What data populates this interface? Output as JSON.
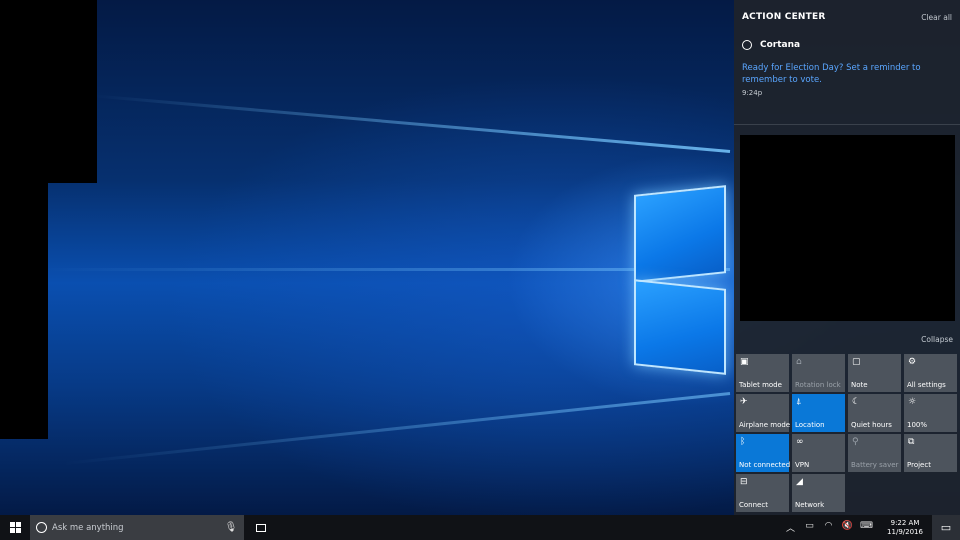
{
  "action_center": {
    "title": "ACTION CENTER",
    "clear_all": "Clear all",
    "notification": {
      "app": "Cortana",
      "message": "Ready for Election Day? Set a reminder to remember to vote.",
      "time": "9:24p"
    },
    "collapse": "Collapse",
    "quick_actions": [
      {
        "label": "Tablet mode",
        "icon": "tablet-mode-icon",
        "glyph": "▣",
        "state": "normal"
      },
      {
        "label": "Rotation lock",
        "icon": "rotation-lock-icon",
        "glyph": "⌂",
        "state": "disabled"
      },
      {
        "label": "Note",
        "icon": "note-icon",
        "glyph": "▢",
        "state": "normal"
      },
      {
        "label": "All settings",
        "icon": "gear-icon",
        "glyph": "⚙",
        "state": "normal"
      },
      {
        "label": "Airplane mode",
        "icon": "airplane-icon",
        "glyph": "✈",
        "state": "normal"
      },
      {
        "label": "Location",
        "icon": "location-icon",
        "glyph": "⍋",
        "state": "on"
      },
      {
        "label": "Quiet hours",
        "icon": "moon-icon",
        "glyph": "☾",
        "state": "normal"
      },
      {
        "label": "100%",
        "icon": "brightness-icon",
        "glyph": "☼",
        "state": "normal"
      },
      {
        "label": "Not connected",
        "icon": "bluetooth-icon",
        "glyph": "ᛒ",
        "state": "on"
      },
      {
        "label": "VPN",
        "icon": "vpn-icon",
        "glyph": "∞",
        "state": "normal"
      },
      {
        "label": "Battery saver",
        "icon": "battery-saver-icon",
        "glyph": "⚲",
        "state": "disabled"
      },
      {
        "label": "Project",
        "icon": "project-icon",
        "glyph": "⧉",
        "state": "normal"
      },
      {
        "label": "Connect",
        "icon": "connect-icon",
        "glyph": "⊟",
        "state": "normal"
      },
      {
        "label": "Network",
        "icon": "network-icon",
        "glyph": "◢",
        "state": "normal"
      }
    ],
    "colors": {
      "tile_on": "#0a78d7",
      "tile": "#4d545d",
      "link": "#5aa6ff"
    }
  },
  "taskbar": {
    "search_placeholder": "Ask me anything",
    "clock_time": "9:22 AM",
    "clock_date": "11/9/2016",
    "tray_icons": [
      {
        "icon": "chevron-up-icon",
        "glyph": "︿"
      },
      {
        "icon": "battery-icon",
        "glyph": "▭"
      },
      {
        "icon": "wifi-icon",
        "glyph": "◠"
      },
      {
        "icon": "volume-mute-icon",
        "glyph": "🔇"
      },
      {
        "icon": "keyboard-icon",
        "glyph": "⌨"
      }
    ]
  }
}
